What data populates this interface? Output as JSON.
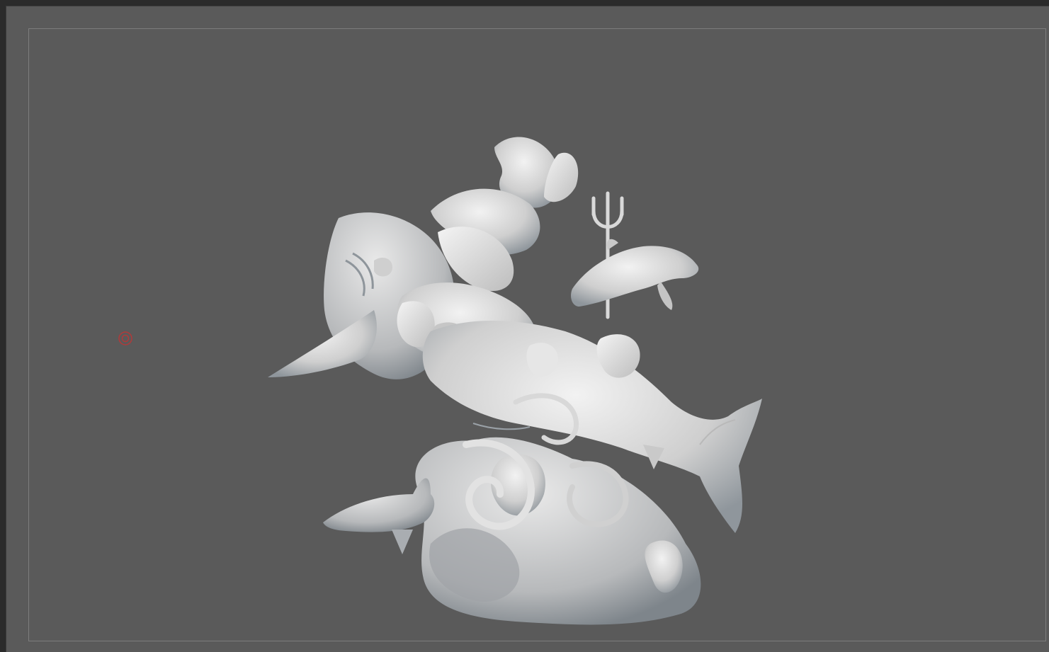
{
  "viewport": {
    "background_color": "#5a5a5a",
    "frame_color": "#7d7d7d",
    "model": {
      "icon": "sculpted-mesh-statue",
      "surface_color": "#d8d8d8",
      "shadow_color": "#9aa4ac"
    },
    "pivot_marker": {
      "icon": "target-circle-icon",
      "color": "#b13a3a"
    }
  }
}
